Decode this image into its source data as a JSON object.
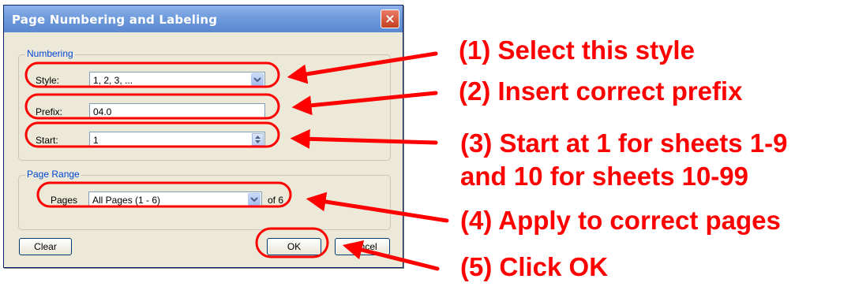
{
  "dialog": {
    "title": "Page Numbering and Labeling",
    "close_glyph": "×",
    "numbering": {
      "legend": "Numbering",
      "style_label": "Style:",
      "style_value": "1, 2, 3, ...",
      "prefix_label": "Prefix:",
      "prefix_value": "04.0",
      "start_label": "Start:",
      "start_value": "1"
    },
    "page_range": {
      "legend": "Page Range",
      "pages_label": "Pages",
      "pages_value": "All Pages (1 - 6)",
      "of_text": "of 6"
    },
    "buttons": {
      "clear": "Clear",
      "ok": "OK",
      "cancel": "Cancel"
    }
  },
  "annotations": {
    "step1": "(1) Select this style",
    "step2": "(2) Insert correct prefix",
    "step3_line1": "(3) Start at 1 for sheets 1-9",
    "step3_line2": "and 10 for sheets 10-99",
    "step4": "(4) Apply to correct pages",
    "step5": "(5) Click OK"
  },
  "colors": {
    "annotation": "#ff0000",
    "titlebar": "#6f9bdc",
    "dialog_bg": "#ece9d8",
    "legend": "#0046d5"
  }
}
